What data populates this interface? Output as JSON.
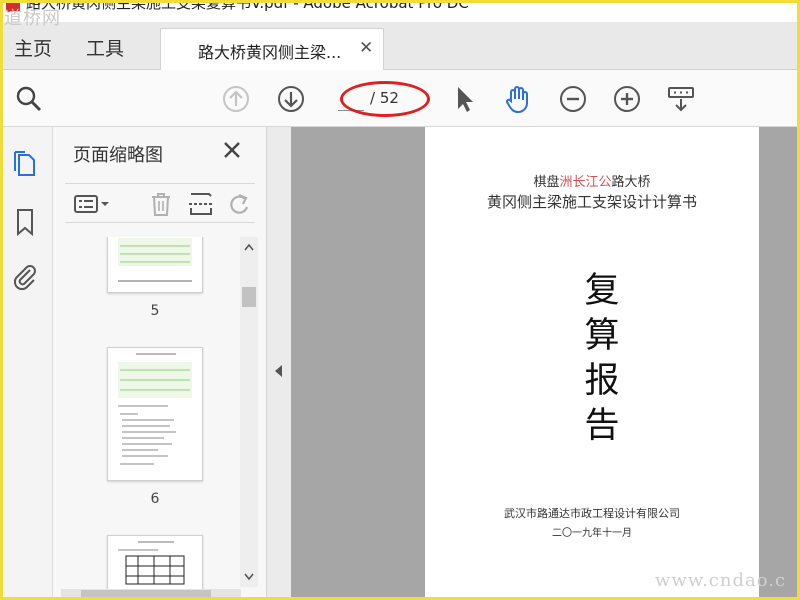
{
  "window": {
    "title": "路大桥黄冈侧主梁施工支架复算书V.pdf - Adobe Acrobat Pro DC"
  },
  "watermarks": {
    "top": "道桥网",
    "bottom": "www.cndao.c"
  },
  "tabs": {
    "home": "主页",
    "tools": "工具",
    "document": "路大桥黄冈侧主梁..."
  },
  "toolbar": {
    "page_current": "",
    "page_total": "/ 52",
    "icons": [
      "search-icon",
      "prev-page-icon",
      "next-page-icon",
      "select-cursor-icon",
      "hand-tool-icon",
      "zoom-out-icon",
      "zoom-in-icon",
      "page-display-icon"
    ]
  },
  "panel": {
    "title": "页面缩略图",
    "thumbnails": [
      {
        "label": "5"
      },
      {
        "label": "6"
      },
      {
        "label": ""
      }
    ]
  },
  "document": {
    "line1_prefix": "棋盘",
    "line1_highlight": "洲长江公",
    "line1_suffix": "路大桥",
    "line2": "黄冈侧主梁施工支架设计计算书",
    "big_title": [
      "复",
      "算",
      "报",
      "告"
    ],
    "org": "武汉市路通达市政工程设计有限公司",
    "date": "二〇一九年十一月"
  },
  "colors": {
    "accent_blue": "#2a6fdb",
    "highlight_red": "#dd2020",
    "frame_yellow": "#f1dc3a"
  }
}
